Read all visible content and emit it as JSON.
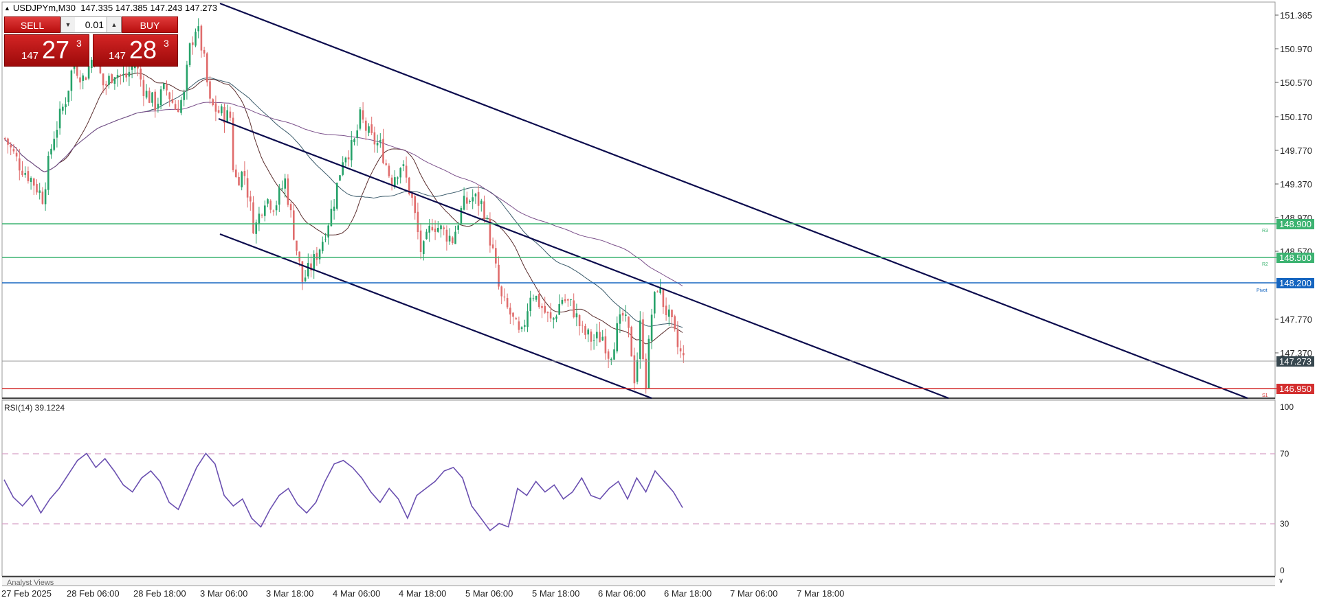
{
  "symbol_header": {
    "symbol": "USDJPYm,M30",
    "ohlc": "147.335 147.385 147.243 147.273"
  },
  "trade_panel": {
    "sell_label": "SELL",
    "buy_label": "BUY",
    "lot_value": "0.01",
    "bid": {
      "prefix": "147",
      "big": "27",
      "sup": "3"
    },
    "ask": {
      "prefix": "147",
      "big": "28",
      "sup": "3"
    }
  },
  "colors": {
    "up_candle": "#26a269",
    "down_candle": "#e06c6c",
    "channel": "#0b0b4d",
    "resistance": "#3cb371",
    "pivot": "#1565c0",
    "support": "#d32f2f",
    "rsi_line": "#6a4fb0",
    "rsi_level": "#d8a0c8"
  },
  "chart_data": {
    "type": "candlestick",
    "symbol": "USDJPYm",
    "timeframe": "M30",
    "y_ticks": [
      "151.365",
      "150.970",
      "150.570",
      "150.170",
      "149.770",
      "149.370",
      "148.970",
      "148.570",
      "147.770",
      "147.370"
    ],
    "x_ticks": [
      "27 Feb 2025",
      "28 Feb 06:00",
      "28 Feb 18:00",
      "3 Mar 06:00",
      "3 Mar 18:00",
      "4 Mar 06:00",
      "4 Mar 18:00",
      "5 Mar 06:00",
      "5 Mar 18:00",
      "6 Mar 06:00",
      "6 Mar 18:00",
      "7 Mar 06:00",
      "7 Mar 18:00"
    ],
    "ylim": [
      146.8,
      151.45
    ],
    "close_path": [
      [
        0,
        149.9
      ],
      [
        20,
        149.6
      ],
      [
        40,
        149.4
      ],
      [
        55,
        149.2
      ],
      [
        70,
        149.9
      ],
      [
        90,
        150.4
      ],
      [
        100,
        150.8
      ],
      [
        115,
        150.6
      ],
      [
        130,
        150.9
      ],
      [
        145,
        150.5
      ],
      [
        160,
        150.7
      ],
      [
        175,
        150.6
      ],
      [
        190,
        150.8
      ],
      [
        205,
        150.45
      ],
      [
        220,
        150.3
      ],
      [
        235,
        150.5
      ],
      [
        250,
        150.25
      ],
      [
        262,
        150.4
      ],
      [
        270,
        150.95
      ],
      [
        280,
        151.25
      ],
      [
        290,
        150.9
      ],
      [
        300,
        150.3
      ],
      [
        315,
        150.2
      ],
      [
        330,
        150.15
      ],
      [
        335,
        149.4
      ],
      [
        350,
        149.5
      ],
      [
        365,
        148.8
      ],
      [
        380,
        149.2
      ],
      [
        395,
        149.1
      ],
      [
        410,
        149.4
      ],
      [
        420,
        148.9
      ],
      [
        435,
        148.2
      ],
      [
        450,
        148.4
      ],
      [
        465,
        148.7
      ],
      [
        480,
        149.1
      ],
      [
        495,
        149.7
      ],
      [
        510,
        149.8
      ],
      [
        520,
        150.15
      ],
      [
        535,
        149.9
      ],
      [
        550,
        149.8
      ],
      [
        565,
        149.4
      ],
      [
        580,
        149.6
      ],
      [
        595,
        149.2
      ],
      [
        610,
        148.5
      ],
      [
        625,
        148.9
      ],
      [
        640,
        148.8
      ],
      [
        655,
        148.7
      ],
      [
        670,
        149.1
      ],
      [
        685,
        149.2
      ],
      [
        700,
        149.1
      ],
      [
        715,
        148.5
      ],
      [
        725,
        148.0
      ],
      [
        740,
        147.8
      ],
      [
        755,
        147.5
      ],
      [
        770,
        148.1
      ],
      [
        785,
        147.9
      ],
      [
        800,
        147.7
      ],
      [
        815,
        148.0
      ],
      [
        830,
        147.9
      ],
      [
        845,
        147.6
      ],
      [
        860,
        147.5
      ],
      [
        875,
        147.55
      ],
      [
        885,
        147.3
      ],
      [
        895,
        147.6
      ],
      [
        905,
        147.8
      ],
      [
        915,
        147.5
      ],
      [
        922,
        147.0
      ],
      [
        930,
        147.7
      ],
      [
        938,
        147.0
      ],
      [
        946,
        147.8
      ],
      [
        955,
        148.15
      ],
      [
        965,
        147.9
      ],
      [
        975,
        147.7
      ],
      [
        985,
        147.4
      ],
      [
        993,
        147.27
      ]
    ],
    "horizontal_levels": [
      {
        "label": "R3",
        "value": "148.900"
      },
      {
        "label": "R2",
        "value": "148.500"
      },
      {
        "label": "Pivot",
        "value": "148.200"
      },
      {
        "label": "S1",
        "value": "146.950"
      }
    ],
    "current_price": "147.273"
  },
  "rsi_panel": {
    "title": "RSI(14) 39.1224",
    "levels": [
      "100",
      "70",
      "30",
      "0"
    ],
    "values": [
      55,
      45,
      40,
      46,
      36,
      44,
      50,
      58,
      66,
      70,
      62,
      67,
      60,
      52,
      48,
      56,
      60,
      54,
      42,
      38,
      50,
      62,
      70,
      64,
      46,
      40,
      44,
      33,
      28,
      38,
      46,
      50,
      41,
      36,
      42,
      54,
      64,
      66,
      62,
      56,
      48,
      42,
      50,
      44,
      33,
      46,
      50,
      54,
      60,
      62,
      56,
      40,
      33,
      26,
      30,
      28,
      50,
      46,
      54,
      48,
      52,
      44,
      48,
      56,
      46,
      44,
      50,
      54,
      44,
      56,
      48,
      60,
      54,
      48,
      39
    ]
  },
  "bottom_bar": {
    "label": "Analyst Views"
  }
}
